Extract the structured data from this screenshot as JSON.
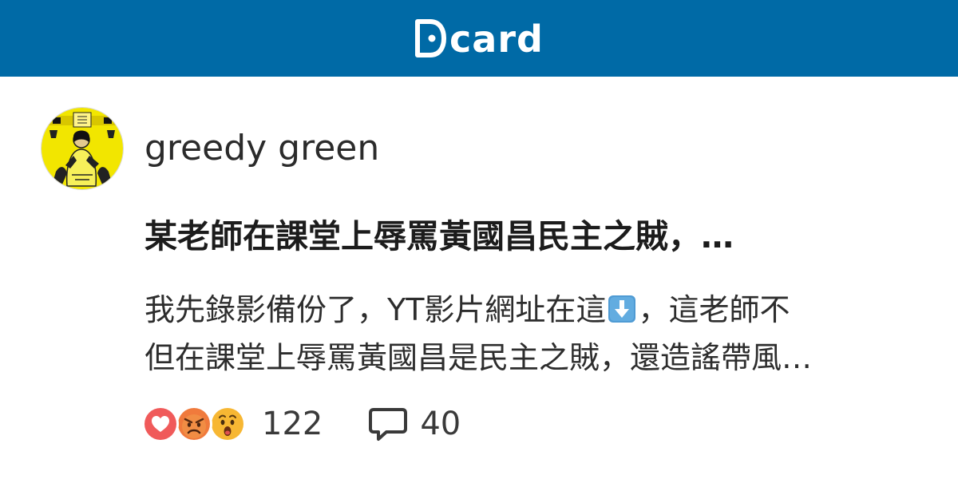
{
  "header": {
    "brand": "card",
    "logo_icon": "dcard-d-icon",
    "background_color": "#006aa6"
  },
  "post": {
    "author": "greedy green",
    "avatar_icon": "yellow-portrait-avatar",
    "title": "某老師在課堂上辱罵黃國昌民主之賊，…",
    "excerpt_line1_before": "我先錄影備份了，YT影片網址在這",
    "excerpt_line1_emoji": "down-arrow-emoji",
    "excerpt_line1_after": "，這老師不",
    "excerpt_line2": "但在課堂上辱罵黃國昌是民主之賊，還造謠帶風…",
    "reactions": [
      "heart-reaction",
      "angry-reaction",
      "surprised-reaction"
    ],
    "reaction_count": "122",
    "comment_count": "40",
    "accent_color": "#006aa6"
  }
}
